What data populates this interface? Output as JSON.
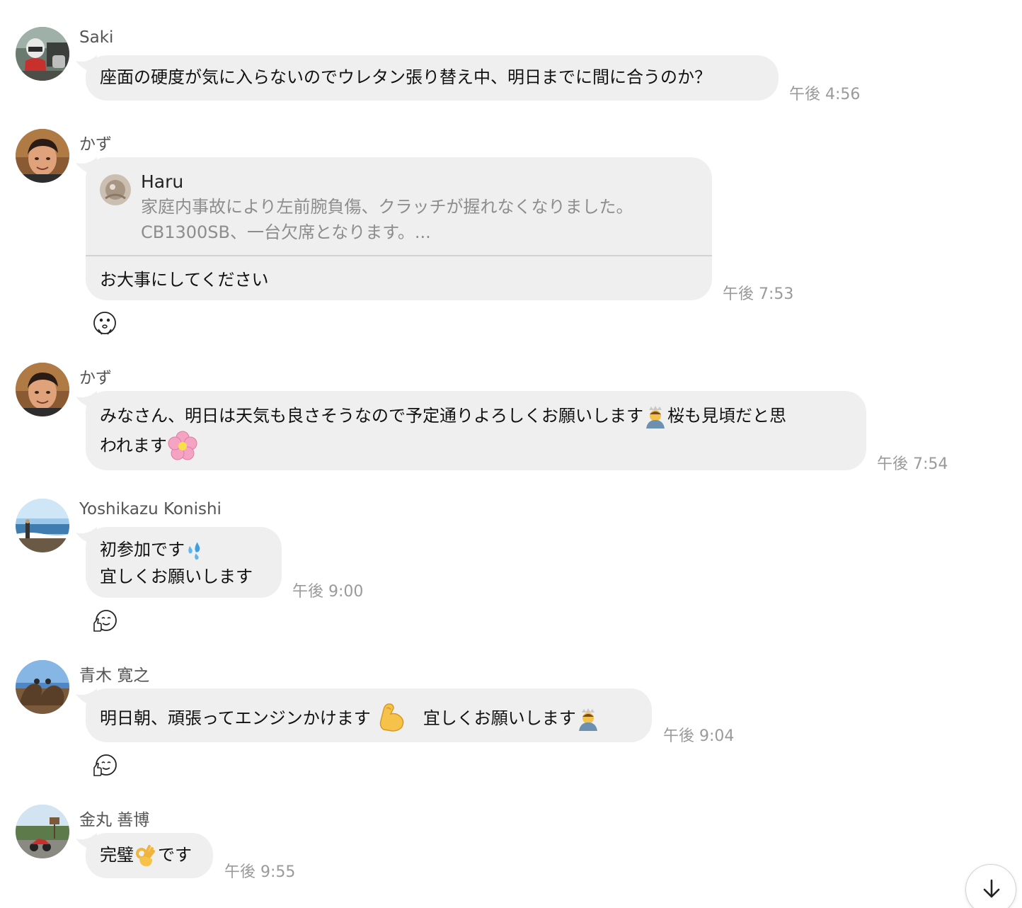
{
  "messages": [
    {
      "sender": "Saki",
      "text": "座面の硬度が気に入らないのでウレタン張り替え中、明日までに間に合うのか？",
      "time": "午後 4:56"
    },
    {
      "sender": "かず",
      "reply": {
        "name": "Haru",
        "line1": "家庭内事故により左前腕負傷、クラッチが握れなくなりました。",
        "line2": "CB1300SB、一台欠席となります。..."
      },
      "text": "お大事にしてください",
      "time": "午後 7:53",
      "reaction": "worried-face-sticker-icon"
    },
    {
      "sender": "かず",
      "text_line1": "みなさん、明日は天気も良さそうなので予定通りよろしくお願いします",
      "text_mid": "桜も見頃だと思",
      "text_line2": "われます",
      "emoji1": "bowing-person-icon",
      "emoji2": "cherry-blossom-icon",
      "time": "午後 7:54"
    },
    {
      "sender": "Yoshikazu Konishi",
      "text_line1": "初参加です",
      "text_line2": "宜しくお願いします",
      "emoji1": "sweat-droplets-icon",
      "time": "午後 9:00",
      "reaction": "thumbs-up-face-sticker-icon"
    },
    {
      "sender": "青木 寛之",
      "text_a": "明日朝、頑張ってエンジンかけます",
      "text_b": "宜しくお願いします",
      "emoji1": "flexed-biceps-icon",
      "emoji2": "bowing-person-icon",
      "time": "午後 9:04",
      "reaction": "thumbs-up-face-sticker-icon"
    },
    {
      "sender": "金丸 善博",
      "text_a": "完璧",
      "text_b": "です",
      "emoji1": "ok-hand-icon",
      "time": "午後 9:55"
    }
  ],
  "scroll_button": {
    "icon": "arrow-down-icon"
  }
}
